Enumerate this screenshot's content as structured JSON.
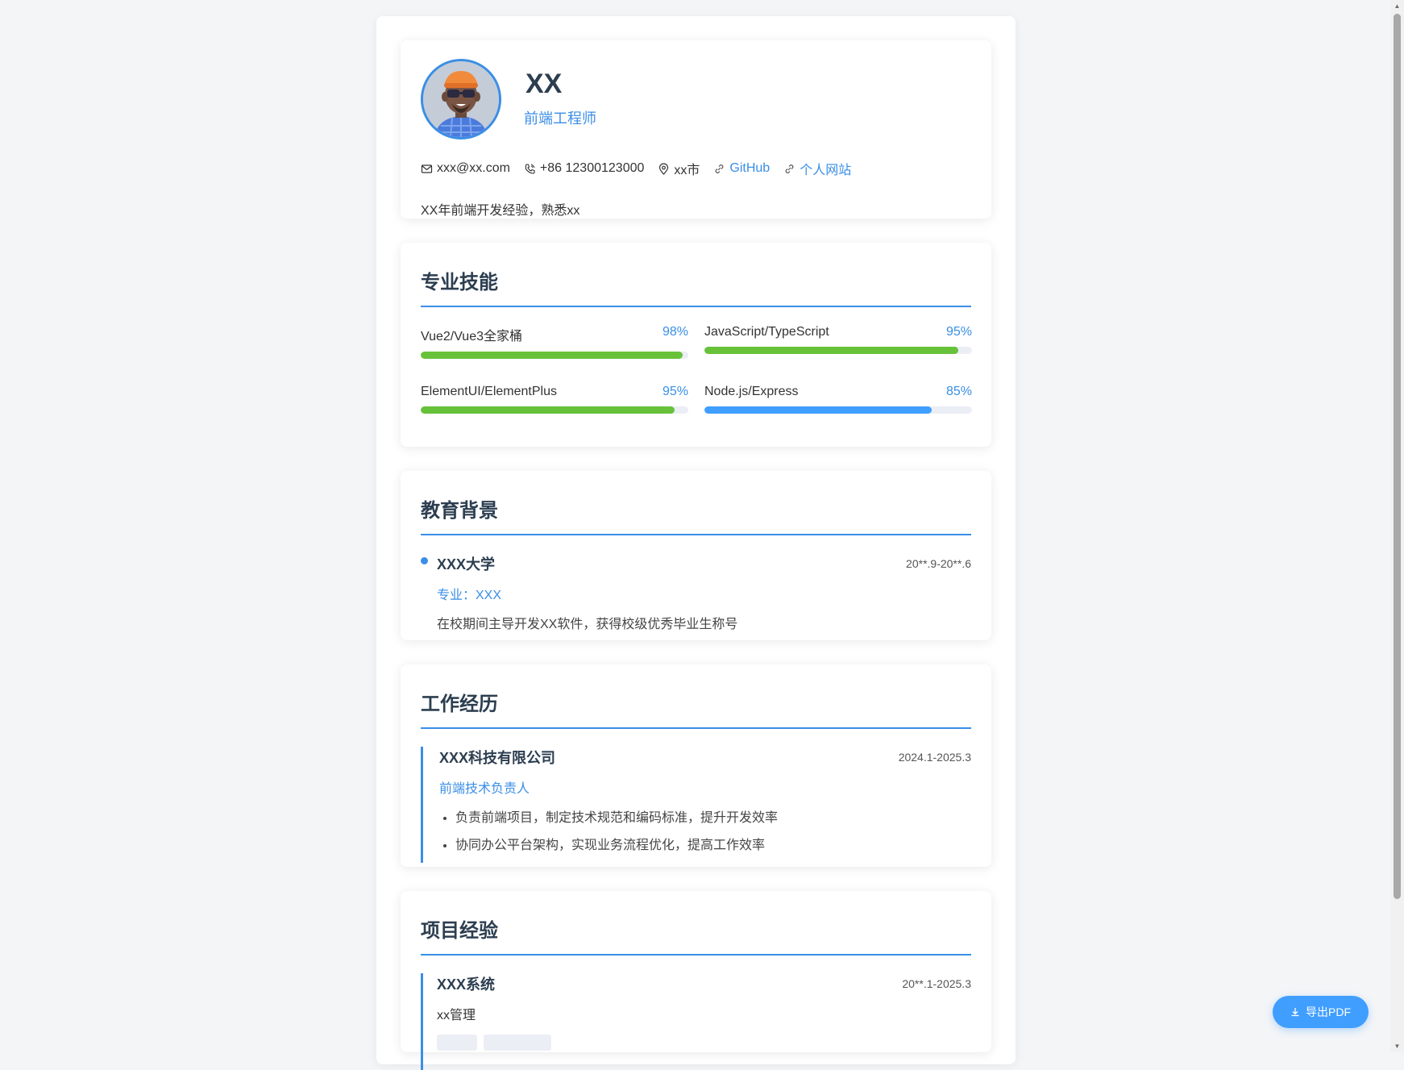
{
  "profile": {
    "name": "XX",
    "title": "前端工程师",
    "contacts": {
      "email": "xxx@xx.com",
      "phone": "+86 12300123000",
      "location": "xx市",
      "github": "GitHub",
      "website": "个人网站"
    },
    "summary": "XX年前端开发经验，熟悉xx"
  },
  "skills": {
    "title": "专业技能",
    "items": [
      {
        "name": "Vue2/Vue3全家桶",
        "percent_label": "98%",
        "level": 0.98,
        "color": "#67c23a"
      },
      {
        "name": "JavaScript/TypeScript",
        "percent_label": "95%",
        "level": 0.95,
        "color": "#67c23a"
      },
      {
        "name": "ElementUI/ElementPlus",
        "percent_label": "95%",
        "level": 0.95,
        "color": "#67c23a"
      },
      {
        "name": "Node.js/Express",
        "percent_label": "85%",
        "level": 0.85,
        "color": "#409eff"
      }
    ]
  },
  "education": {
    "title": "教育背景",
    "items": [
      {
        "school": "XXX大学",
        "date": "20**.9-20**.6",
        "major": "专业：XXX",
        "desc": "在校期间主导开发XX软件，获得校级优秀毕业生称号"
      }
    ]
  },
  "work": {
    "title": "工作经历",
    "items": [
      {
        "company": "XXX科技有限公司",
        "date": "2024.1-2025.3",
        "role": "前端技术负责人",
        "duties": [
          "负责前端项目，制定技术规范和编码标准，提升开发效率",
          "协同办公平台架构，实现业务流程优化，提高工作效率"
        ]
      }
    ]
  },
  "projects": {
    "title": "项目经验",
    "items": [
      {
        "name": "XXX系统",
        "date": "20**.1-2025.3",
        "desc": "xx管理"
      }
    ]
  },
  "export_button": {
    "label": "导出PDF"
  },
  "icons": {
    "email": "mail-icon",
    "phone": "phone-icon",
    "location": "location-pin-icon",
    "link": "link-icon",
    "download": "download-icon"
  },
  "colors": {
    "accent": "#3a8ee6",
    "bar_green": "#67c23a",
    "bar_blue": "#409eff",
    "button": "#409eff"
  }
}
